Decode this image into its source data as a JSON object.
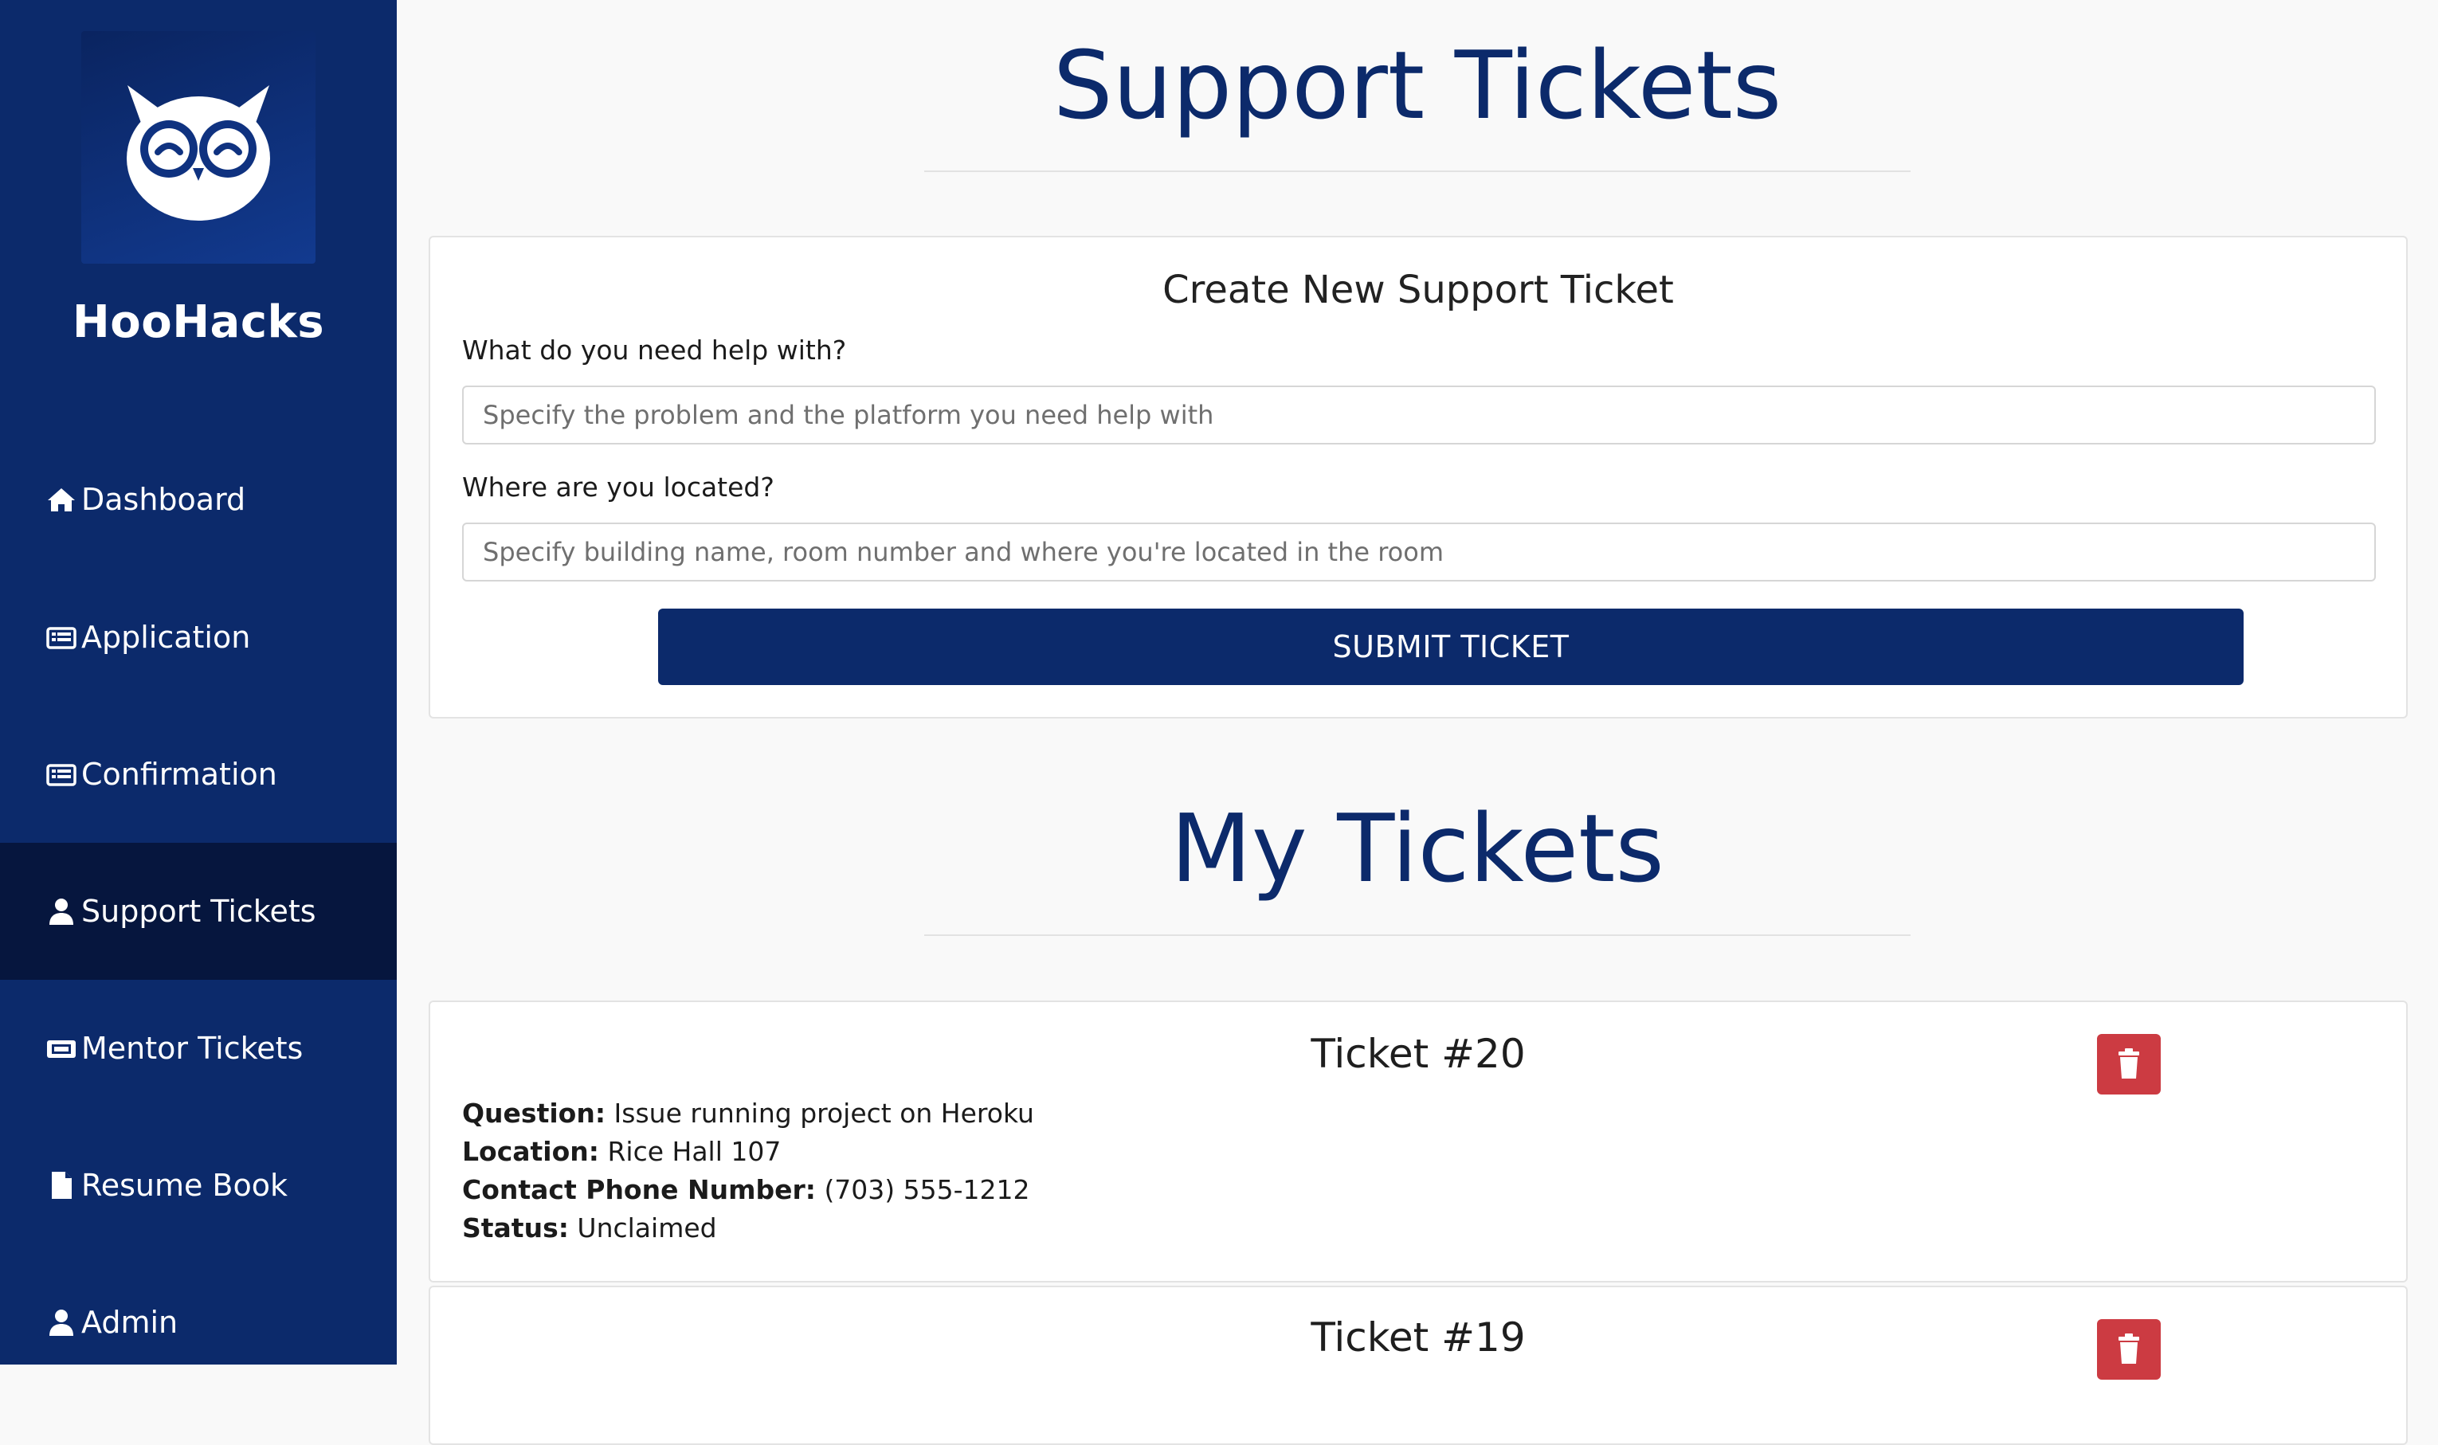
{
  "sidebar": {
    "brand": "HooHacks",
    "items": [
      {
        "label": "Dashboard",
        "icon": "home-icon"
      },
      {
        "label": "Application",
        "icon": "form-icon"
      },
      {
        "label": "Confirmation",
        "icon": "form-icon"
      },
      {
        "label": "Support Tickets",
        "icon": "user-icon",
        "active": true
      },
      {
        "label": "Mentor Tickets",
        "icon": "ticket-icon"
      },
      {
        "label": "Resume Book",
        "icon": "file-icon"
      },
      {
        "label": "Admin",
        "icon": "user-icon"
      }
    ]
  },
  "main": {
    "heading": "Support Tickets",
    "create_form": {
      "title": "Create New Support Ticket",
      "help_label": "What do you need help with?",
      "help_placeholder": "Specify the problem and the platform you need help with",
      "location_label": "Where are you located?",
      "location_placeholder": "Specify building name, room number and where you're located in the room",
      "submit_label": "SUBMIT TICKET"
    },
    "my_tickets_heading": "My Tickets",
    "tickets": [
      {
        "title": "Ticket #20",
        "question_label": "Question:",
        "question": "Issue running project on Heroku",
        "location_label": "Location:",
        "location": "Rice Hall 107",
        "phone_label": "Contact Phone Number:",
        "phone": "(703) 555-1212",
        "status_label": "Status:",
        "status": "Unclaimed"
      },
      {
        "title": "Ticket #19"
      }
    ]
  },
  "colors": {
    "sidebar": "#0c2a6b",
    "sidebar_active": "#06163e",
    "primary": "#0c2a6b",
    "danger": "#cc3b42"
  }
}
